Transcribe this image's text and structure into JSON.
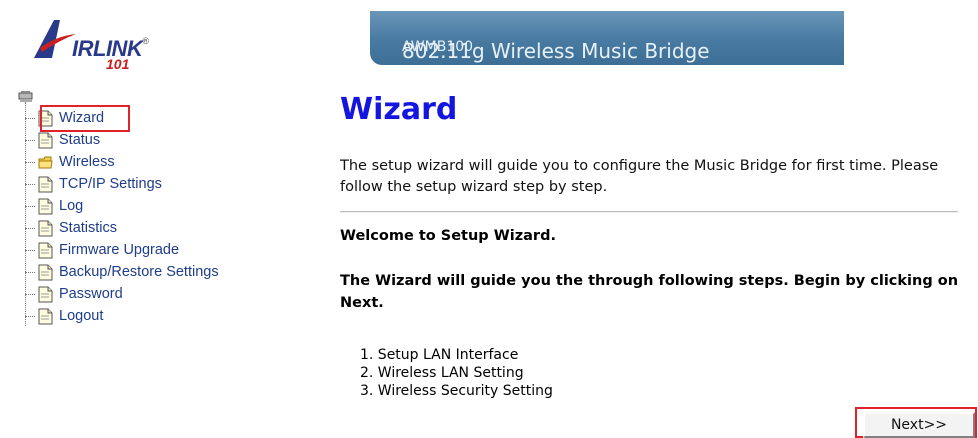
{
  "logo": {
    "brand": "IRLINK",
    "registered": "®",
    "number": "101"
  },
  "banner": {
    "model": "AWMB100",
    "title": " 802.11g Wireless Music Bridge"
  },
  "menu": {
    "items": [
      {
        "label": "Wizard",
        "icon": "page-icon",
        "selected": true
      },
      {
        "label": "Status",
        "icon": "page-icon"
      },
      {
        "label": "Wireless",
        "icon": "folder-icon"
      },
      {
        "label": "TCP/IP Settings",
        "icon": "page-icon"
      },
      {
        "label": "Log",
        "icon": "page-icon"
      },
      {
        "label": "Statistics",
        "icon": "page-icon"
      },
      {
        "label": "Firmware Upgrade",
        "icon": "page-icon"
      },
      {
        "label": "Backup/Restore Settings",
        "icon": "page-icon"
      },
      {
        "label": "Password",
        "icon": "page-icon"
      },
      {
        "label": "Logout",
        "icon": "page-icon"
      }
    ]
  },
  "main": {
    "title": "Wizard",
    "description": "The setup wizard will guide you to configure the Music Bridge for first time. Please follow the setup wizard step by step.",
    "welcome": "Welcome to Setup Wizard.",
    "guide": "The Wizard will guide you the through following steps. Begin by clicking on Next.",
    "steps": [
      "1. Setup LAN Interface",
      "2. Wireless LAN Setting",
      "3. Wireless Security Setting"
    ],
    "next_label": "Next>>"
  },
  "colors": {
    "title": "#1515e0",
    "link": "#1f3d8a",
    "highlight": "#e0232a",
    "banner": "#4a7ca3"
  }
}
